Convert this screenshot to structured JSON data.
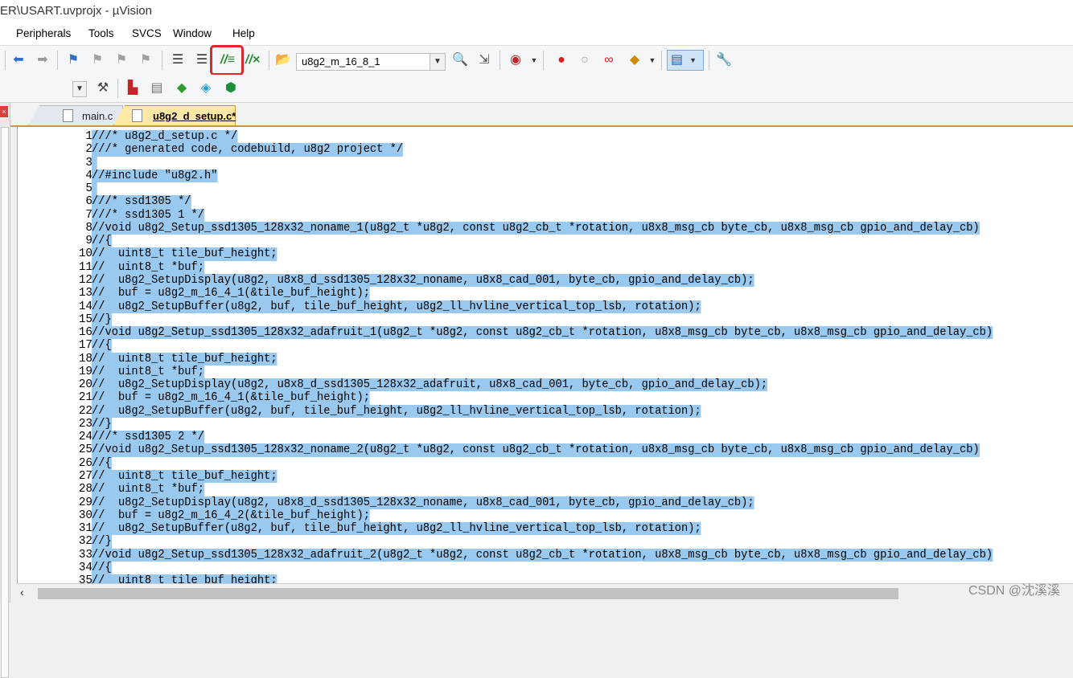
{
  "window": {
    "title": "ER\\USART.uvprojx - µVision"
  },
  "menu": [
    "Peripherals",
    "Tools",
    "SVCS",
    "Window",
    "Help"
  ],
  "toolbar": {
    "target_select": "u8g2_m_16_8_1"
  },
  "tabs": [
    {
      "label": "main.c",
      "active": false
    },
    {
      "label": "u8g2_d_setup.c*",
      "active": true
    }
  ],
  "editor": {
    "lines": [
      {
        "n": "1",
        "t": "///* u8g2_d_setup.c */"
      },
      {
        "n": "2",
        "t": "///* generated code, codebuild, u8g2 project */"
      },
      {
        "n": "3",
        "t": ""
      },
      {
        "n": "4",
        "t": "//#include \"u8g2.h\""
      },
      {
        "n": "5",
        "t": ""
      },
      {
        "n": "6",
        "t": "///* ssd1305 */"
      },
      {
        "n": "7",
        "t": "///* ssd1305 1 */"
      },
      {
        "n": "8",
        "t": "//void u8g2_Setup_ssd1305_128x32_noname_1(u8g2_t *u8g2, const u8g2_cb_t *rotation, u8x8_msg_cb byte_cb, u8x8_msg_cb gpio_and_delay_cb)"
      },
      {
        "n": "9",
        "t": "//{"
      },
      {
        "n": "10",
        "t": "//  uint8_t tile_buf_height;"
      },
      {
        "n": "11",
        "t": "//  uint8_t *buf;"
      },
      {
        "n": "12",
        "t": "//  u8g2_SetupDisplay(u8g2, u8x8_d_ssd1305_128x32_noname, u8x8_cad_001, byte_cb, gpio_and_delay_cb);"
      },
      {
        "n": "13",
        "t": "//  buf = u8g2_m_16_4_1(&tile_buf_height);"
      },
      {
        "n": "14",
        "t": "//  u8g2_SetupBuffer(u8g2, buf, tile_buf_height, u8g2_ll_hvline_vertical_top_lsb, rotation);"
      },
      {
        "n": "15",
        "t": "//}"
      },
      {
        "n": "16",
        "t": "//void u8g2_Setup_ssd1305_128x32_adafruit_1(u8g2_t *u8g2, const u8g2_cb_t *rotation, u8x8_msg_cb byte_cb, u8x8_msg_cb gpio_and_delay_cb)"
      },
      {
        "n": "17",
        "t": "//{"
      },
      {
        "n": "18",
        "t": "//  uint8_t tile_buf_height;"
      },
      {
        "n": "19",
        "t": "//  uint8_t *buf;"
      },
      {
        "n": "20",
        "t": "//  u8g2_SetupDisplay(u8g2, u8x8_d_ssd1305_128x32_adafruit, u8x8_cad_001, byte_cb, gpio_and_delay_cb);"
      },
      {
        "n": "21",
        "t": "//  buf = u8g2_m_16_4_1(&tile_buf_height);"
      },
      {
        "n": "22",
        "t": "//  u8g2_SetupBuffer(u8g2, buf, tile_buf_height, u8g2_ll_hvline_vertical_top_lsb, rotation);"
      },
      {
        "n": "23",
        "t": "//}"
      },
      {
        "n": "24",
        "t": "///* ssd1305 2 */"
      },
      {
        "n": "25",
        "t": "//void u8g2_Setup_ssd1305_128x32_noname_2(u8g2_t *u8g2, const u8g2_cb_t *rotation, u8x8_msg_cb byte_cb, u8x8_msg_cb gpio_and_delay_cb)"
      },
      {
        "n": "26",
        "t": "//{"
      },
      {
        "n": "27",
        "t": "//  uint8_t tile_buf_height;"
      },
      {
        "n": "28",
        "t": "//  uint8_t *buf;"
      },
      {
        "n": "29",
        "t": "//  u8g2_SetupDisplay(u8g2, u8x8_d_ssd1305_128x32_noname, u8x8_cad_001, byte_cb, gpio_and_delay_cb);"
      },
      {
        "n": "30",
        "t": "//  buf = u8g2_m_16_4_2(&tile_buf_height);"
      },
      {
        "n": "31",
        "t": "//  u8g2_SetupBuffer(u8g2, buf, tile_buf_height, u8g2_ll_hvline_vertical_top_lsb, rotation);"
      },
      {
        "n": "32",
        "t": "//}"
      },
      {
        "n": "33",
        "t": "//void u8g2_Setup_ssd1305_128x32_adafruit_2(u8g2_t *u8g2, const u8g2_cb_t *rotation, u8x8_msg_cb byte_cb, u8x8_msg_cb gpio_and_delay_cb)"
      },
      {
        "n": "34",
        "t": "//{"
      },
      {
        "n": "35",
        "t": "//  uint8_t tile_buf_height;"
      }
    ],
    "selection_color": "#99c9ef"
  },
  "watermark": "CSDN @沈溪溪",
  "colors": {
    "highlight_box": "#e3262b",
    "active_tab": "#ffe9a6"
  }
}
